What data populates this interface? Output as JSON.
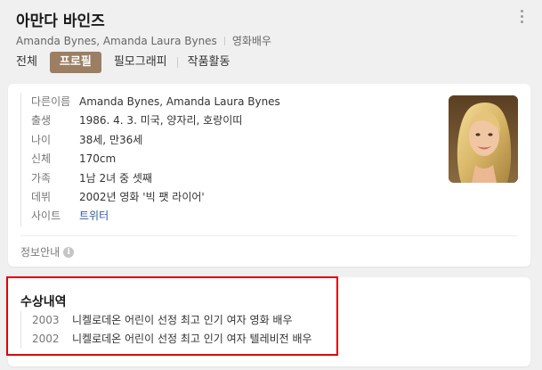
{
  "header": {
    "title": "아만다 바인즈",
    "subtitle_names": "Amanda Bynes, Amanda Laura Bynes",
    "subtitle_job": "영화배우"
  },
  "tabs": [
    {
      "label": "전체",
      "active": false
    },
    {
      "label": "프로필",
      "active": true
    },
    {
      "label": "필모그래피",
      "active": false
    },
    {
      "label": "작품활동",
      "active": false
    }
  ],
  "profile": {
    "rows": [
      {
        "label": "다른이름",
        "value": "Amanda Bynes, Amanda Laura Bynes"
      },
      {
        "label": "출생",
        "value": "1986. 4. 3. 미국, 양자리, 호랑이띠"
      },
      {
        "label": "나이",
        "value": "38세, 만36세"
      },
      {
        "label": "신체",
        "value": "170cm"
      },
      {
        "label": "가족",
        "value": "1남 2녀 중 셋째"
      },
      {
        "label": "데뷔",
        "value": "2002년 영화 '빅 팻 라이어'"
      },
      {
        "label": "사이트",
        "value": "트위터"
      }
    ],
    "notice": "정보안내",
    "info_icon_glyph": "i"
  },
  "awards": {
    "title": "수상내역",
    "items": [
      {
        "year": "2003",
        "name": "니켈로데온 어린이 선정 최고 인기 여자 영화 배우"
      },
      {
        "year": "2002",
        "name": "니켈로데온 어린이 선정 최고 인기 여자 텔레비전 배우"
      }
    ]
  },
  "colors": {
    "accent": "#9c7e63",
    "link": "#2f5aa8",
    "highlight": "#e00000"
  }
}
